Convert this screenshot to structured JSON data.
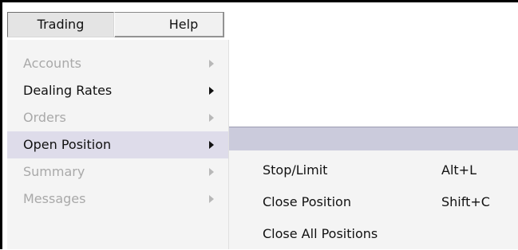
{
  "menubar": {
    "trading_label": "Trading",
    "help_label": "Help"
  },
  "trading_menu": {
    "items": [
      {
        "label": "Accounts",
        "state": "disabled"
      },
      {
        "label": "Dealing Rates",
        "state": "enabled"
      },
      {
        "label": "Orders",
        "state": "disabled"
      },
      {
        "label": "Open Position",
        "state": "selected"
      },
      {
        "label": "Summary",
        "state": "disabled"
      },
      {
        "label": "Messages",
        "state": "disabled"
      }
    ]
  },
  "open_position_submenu": {
    "items": [
      {
        "label": "Stop/Limit",
        "shortcut": "Alt+L"
      },
      {
        "label": "Close Position",
        "shortcut": "Shift+C"
      },
      {
        "label": "Close All Positions",
        "shortcut": ""
      }
    ]
  },
  "colors": {
    "highlight": "#dedcea",
    "submenu_header": "#cbcbdc",
    "disabled_text": "#a9a9a9",
    "menu_background": "#f4f4f4"
  }
}
